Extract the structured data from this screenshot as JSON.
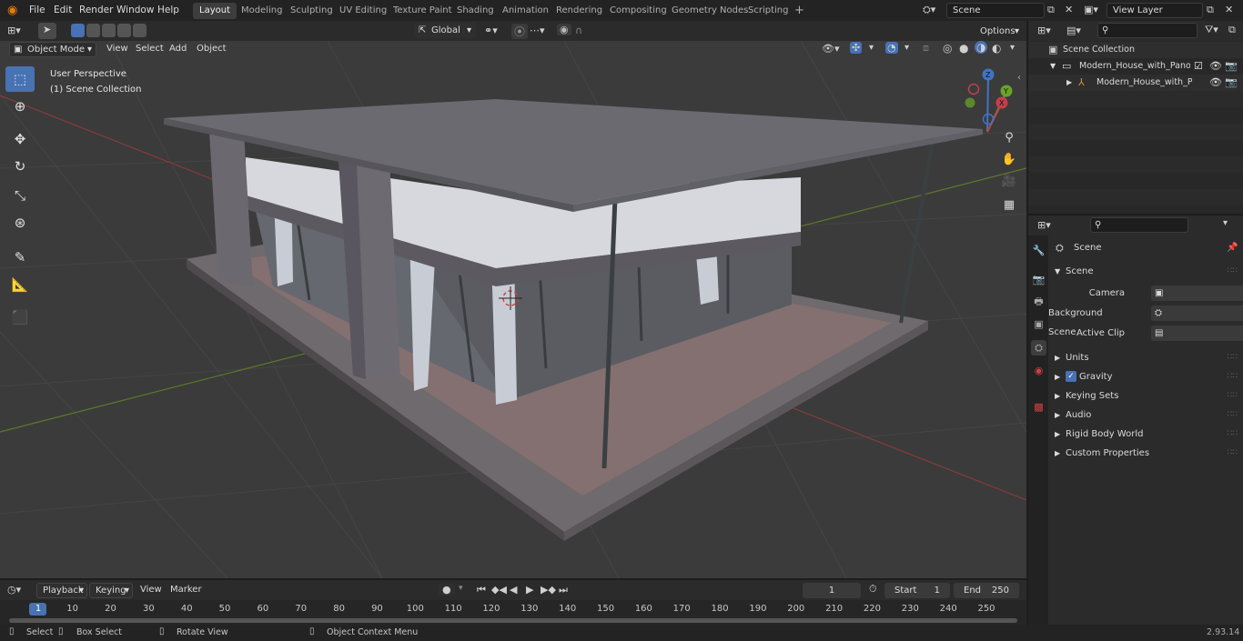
{
  "topbar": {
    "menus": [
      "File",
      "Edit",
      "Render",
      "Window",
      "Help"
    ],
    "workspaces": [
      "Layout",
      "Modeling",
      "Sculpting",
      "UV Editing",
      "Texture Paint",
      "Shading",
      "Animation",
      "Rendering",
      "Compositing",
      "Geometry Nodes",
      "Scripting"
    ],
    "active_workspace": "Layout",
    "scene_name": "Scene",
    "view_layer_name": "View Layer"
  },
  "viewport_header": {
    "mode": "Object Mode",
    "menus": [
      "View",
      "Select",
      "Add",
      "Object"
    ],
    "transform_orientation": "Global",
    "options_label": "Options"
  },
  "viewport": {
    "overlay_line1": "User Perspective",
    "overlay_line2": "(1) Scene Collection",
    "gizmo": {
      "x": "X",
      "y": "Y",
      "z": "Z"
    },
    "colors": {
      "background": "#3b3b3b",
      "roof": "#6a6a70",
      "floor": "#6e6a6e",
      "accent": "#4772b3"
    }
  },
  "outliner": {
    "root": "Scene Collection",
    "items": [
      {
        "label": "Modern_House_with_Panoran",
        "level": 1
      },
      {
        "label": "Modern_House_with_Pan",
        "level": 2
      }
    ]
  },
  "properties": {
    "context": "Scene",
    "panel": "Scene",
    "fields": [
      {
        "label": "Camera",
        "value": ""
      },
      {
        "label": "Background Scene",
        "value": ""
      },
      {
        "label": "Active Clip",
        "value": ""
      }
    ],
    "subpanels": [
      "Units",
      "Gravity",
      "Keying Sets",
      "Audio",
      "Rigid Body World",
      "Custom Properties"
    ],
    "gravity_checked": true
  },
  "timeline": {
    "menus": [
      "Playback",
      "Keying",
      "View",
      "Marker"
    ],
    "current_frame": "1",
    "start_label": "Start",
    "start_value": "1",
    "end_label": "End",
    "end_value": "250",
    "ruler_ticks": [
      "1",
      "10",
      "20",
      "30",
      "40",
      "50",
      "60",
      "70",
      "80",
      "90",
      "100",
      "110",
      "120",
      "130",
      "140",
      "150",
      "160",
      "170",
      "180",
      "190",
      "200",
      "210",
      "220",
      "230",
      "240",
      "250"
    ]
  },
  "statusbar": {
    "select": "Select",
    "box_select": "Box Select",
    "rotate": "Rotate View",
    "context_menu": "Object Context Menu",
    "version": "2.93.14"
  }
}
